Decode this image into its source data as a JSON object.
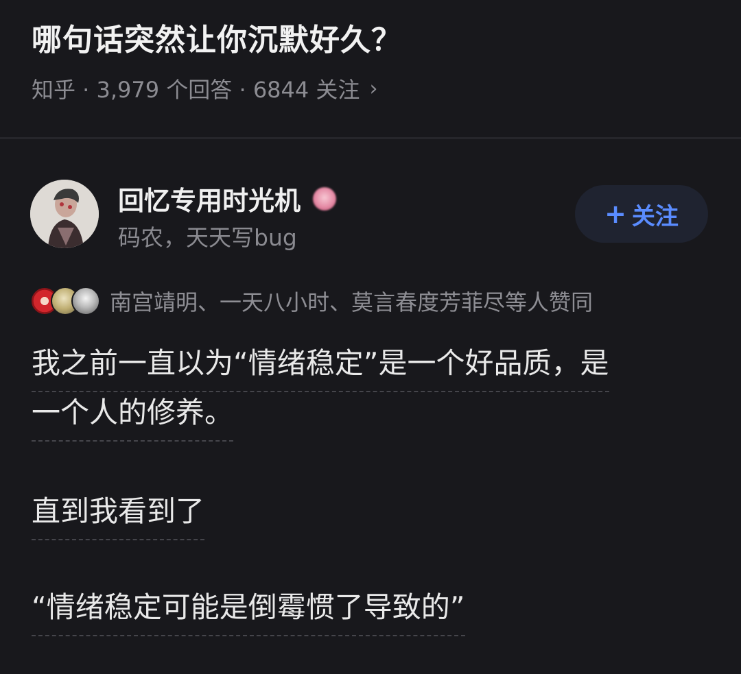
{
  "question": {
    "title": "哪句话突然让你沉默好久？",
    "source": "知乎",
    "answers": "3,979 个回答",
    "followers": "6844 关注",
    "meta_text": "知乎 · 3,979 个回答 · 6844 关注"
  },
  "author": {
    "name": "回忆专用时光机",
    "bio": "码农，天天写bug",
    "follow_label": "关注",
    "follow_plus": "+"
  },
  "upvoters": {
    "text": "南宫靖明、一天八小时、莫言春度芳菲尽等人赞同"
  },
  "answer": {
    "paragraph1_line1": "我之前一直以为“情绪稳定”是一个好品质，是",
    "paragraph1_line2": "一个人的修养。",
    "paragraph2": "直到我看到了",
    "paragraph3": "“情绪稳定可能是倒霉惯了导致的”"
  },
  "colors": {
    "background": "#18181c",
    "accent": "#5a8cff",
    "muted_text": "#8c8c92"
  }
}
